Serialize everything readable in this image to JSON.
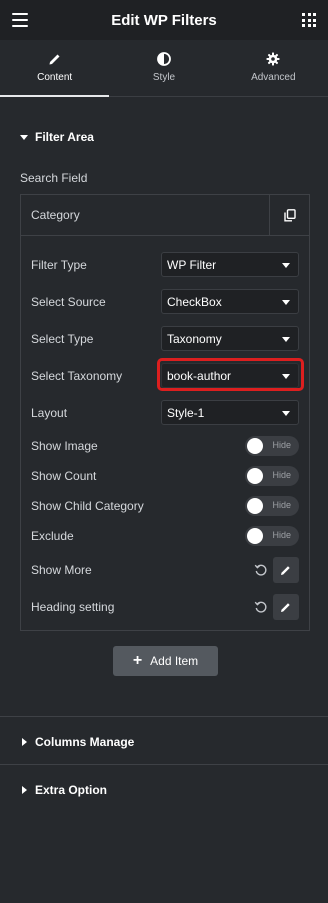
{
  "header": {
    "title": "Edit WP Filters"
  },
  "tabs": [
    {
      "label": "Content",
      "icon": "pencil-icon",
      "active": true
    },
    {
      "label": "Style",
      "icon": "half-circle-icon",
      "active": false
    },
    {
      "label": "Advanced",
      "icon": "gear-icon",
      "active": false
    }
  ],
  "section": {
    "title": "Filter Area"
  },
  "search_field": {
    "label": "Search Field"
  },
  "repeater": {
    "item_title": "Category",
    "fields": {
      "filter_type": {
        "label": "Filter Type",
        "value": "WP Filter"
      },
      "select_source": {
        "label": "Select Source",
        "value": "CheckBox"
      },
      "select_type": {
        "label": "Select Type",
        "value": "Taxonomy"
      },
      "select_taxonomy": {
        "label": "Select Taxonomy",
        "value": "book-author"
      },
      "layout": {
        "label": "Layout",
        "value": "Style-1"
      },
      "show_image": {
        "label": "Show Image",
        "toggle": "Hide"
      },
      "show_count": {
        "label": "Show Count",
        "toggle": "Hide"
      },
      "show_child_category": {
        "label": "Show Child Category",
        "toggle": "Hide"
      },
      "exclude": {
        "label": "Exclude",
        "toggle": "Hide"
      },
      "show_more": {
        "label": "Show More"
      },
      "heading_setting": {
        "label": "Heading setting"
      }
    }
  },
  "add_item": {
    "label": "Add Item"
  },
  "sections_collapsed": [
    {
      "title": "Columns Manage"
    },
    {
      "title": "Extra Option"
    }
  ],
  "colors": {
    "background": "#26292d",
    "highlight": "#dc1f1f"
  }
}
